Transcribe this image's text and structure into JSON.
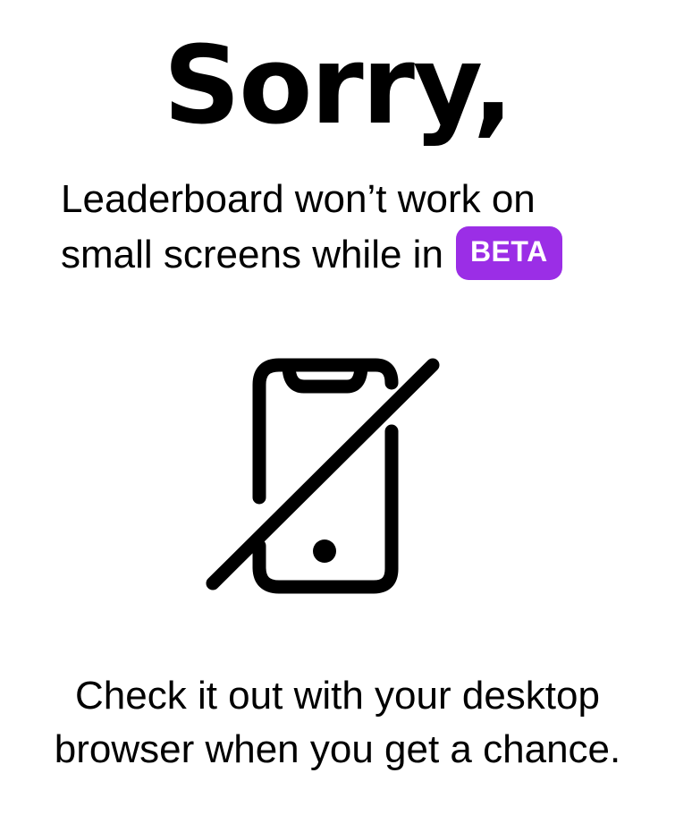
{
  "title": "Sorry,",
  "message": {
    "line1": "Leaderboard won’t work on",
    "line2": "small screens while in",
    "badge": "BETA"
  },
  "icon": "phone-disabled-icon",
  "footer": {
    "line1": "Check it out with your desktop",
    "line2": "browser when you get a chance."
  },
  "colors": {
    "text": "#000000",
    "background": "#ffffff",
    "badge_background": "#9b2ee6",
    "badge_text": "#ffffff"
  }
}
